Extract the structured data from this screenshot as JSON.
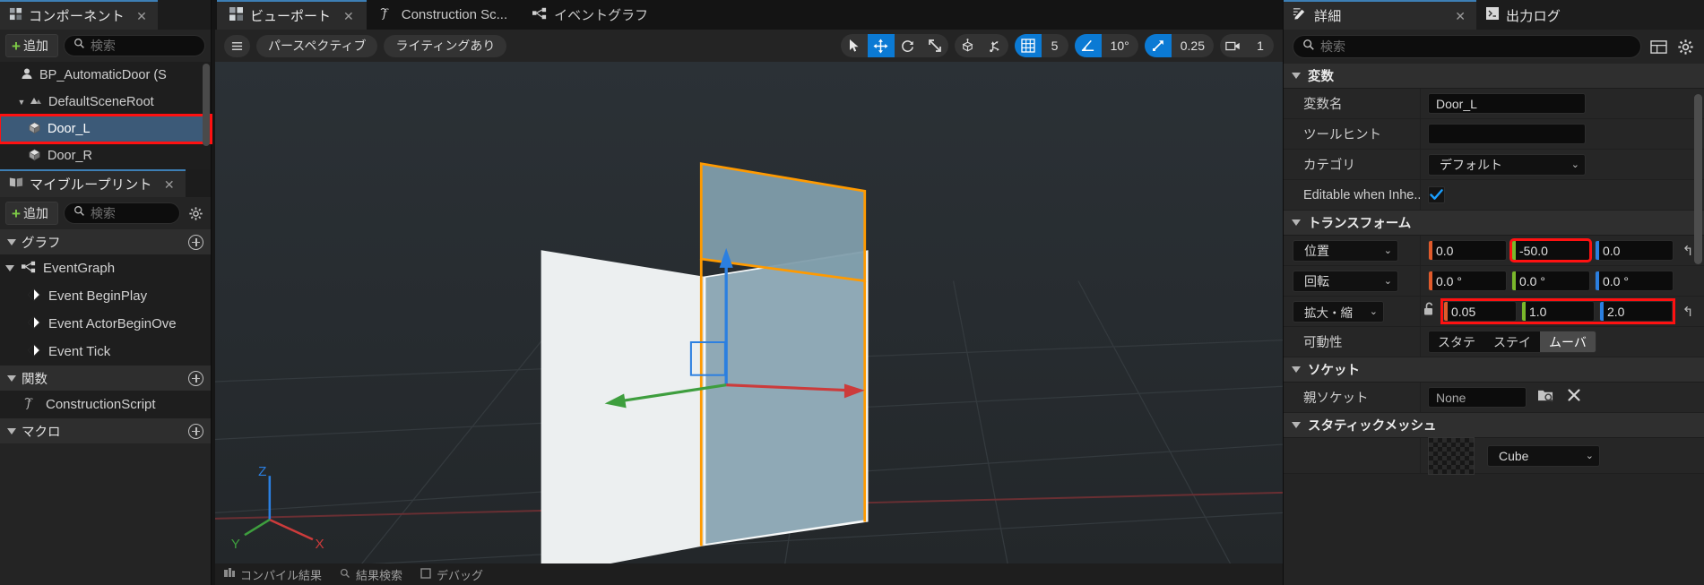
{
  "left": {
    "components_tab": {
      "label": "コンポーネント",
      "icon": "components-icon",
      "close": "✕"
    },
    "add_label": "追加",
    "search_placeholder": "検索",
    "tree": [
      {
        "label": "BP_AutomaticDoor (S",
        "icon": "actor-icon",
        "indent": 0,
        "selected": false,
        "arrow": "",
        "highlight": false
      },
      {
        "label": "DefaultSceneRoot",
        "icon": "scene-root-icon",
        "indent": 1,
        "selected": false,
        "arrow": "▼",
        "highlight": false
      },
      {
        "label": "Door_L",
        "icon": "mesh-icon",
        "indent": 2,
        "selected": true,
        "arrow": "",
        "highlight": true
      },
      {
        "label": "Door_R",
        "icon": "mesh-icon",
        "indent": 2,
        "selected": false,
        "arrow": "",
        "highlight": false
      }
    ],
    "myblueprint_tab": {
      "label": "マイブループリント",
      "icon": "book-icon",
      "close": "✕"
    },
    "sections": [
      {
        "title": "グラフ",
        "items": [
          {
            "label": "EventGraph",
            "icon": "event-graph-icon",
            "indent": 0,
            "arrow": "▼"
          },
          {
            "label": "Event BeginPlay",
            "icon": "event-node-icon",
            "indent": 1,
            "arrow": ""
          },
          {
            "label": "Event ActorBeginOve",
            "icon": "event-node-icon",
            "indent": 1,
            "arrow": ""
          },
          {
            "label": "Event Tick",
            "icon": "event-node-icon",
            "indent": 1,
            "arrow": ""
          }
        ]
      },
      {
        "title": "関数",
        "items": [
          {
            "label": "ConstructionScript",
            "icon": "function-icon",
            "indent": 1,
            "arrow": ""
          }
        ]
      },
      {
        "title": "マクロ",
        "items": []
      }
    ]
  },
  "doc_tabs": [
    {
      "label": "ビューポート",
      "icon": "viewport-icon",
      "active": true,
      "close": "✕"
    },
    {
      "label": "Construction Sc...",
      "icon": "function-icon",
      "active": false,
      "close": ""
    },
    {
      "label": "イベントグラフ",
      "icon": "event-graph-icon",
      "active": false,
      "close": ""
    }
  ],
  "viewport_toolbar": {
    "menu_icon": "hamburger-icon",
    "perspective_label": "パースペクティブ",
    "lighting_label": "ライティングあり",
    "transform_tools": [
      {
        "name": "select-tool",
        "icon": "cursor-icon",
        "active": false
      },
      {
        "name": "move-tool",
        "icon": "move-icon",
        "active": true
      },
      {
        "name": "rotate-tool",
        "icon": "rotate-icon",
        "active": false
      },
      {
        "name": "scale-tool",
        "icon": "scale-icon",
        "active": false
      }
    ],
    "coord_tools": [
      {
        "name": "world-space-toggle",
        "icon": "globe-cube-icon",
        "active": false
      },
      {
        "name": "pivot-toggle",
        "icon": "pivot-icon",
        "active": false
      }
    ],
    "grid_snap": {
      "icon": "grid-icon",
      "active": true,
      "value": "5"
    },
    "angle_snap": {
      "icon": "angle-icon",
      "active": true,
      "value": "10°"
    },
    "scale_snap": {
      "icon": "scale-snap-icon",
      "active": true,
      "value": "0.25"
    },
    "camera_speed": {
      "icon": "camera-icon",
      "active": false,
      "value": "1"
    }
  },
  "viewport_bottom": [
    {
      "label": "コンパイル結果",
      "icon": "compile-icon"
    },
    {
      "label": "結果検索",
      "icon": "search-icon"
    },
    {
      "label": "デバッグ",
      "icon": "debug-icon"
    }
  ],
  "right": {
    "tabs": [
      {
        "label": "詳細",
        "icon": "details-icon",
        "active": true,
        "close": "✕"
      },
      {
        "label": "出力ログ",
        "icon": "output-log-icon",
        "active": false,
        "close": ""
      }
    ],
    "search_placeholder": "検索",
    "column_icon": "columns-icon",
    "settings_icon": "gear-icon",
    "sections": [
      {
        "title": "変数",
        "rows": [
          {
            "kind": "text",
            "name": "変数名",
            "value": "Door_L"
          },
          {
            "kind": "text",
            "name": "ツールヒント",
            "value": ""
          },
          {
            "kind": "combo",
            "name": "カテゴリ",
            "value": "デフォルト"
          },
          {
            "kind": "check",
            "name": "Editable when Inhe...",
            "checked": true
          }
        ]
      },
      {
        "title": "トランスフォーム",
        "rows": [
          {
            "kind": "vector",
            "name": "位置",
            "values": [
              "0.0",
              "-50.0",
              "0.0"
            ],
            "highlight_index": 1,
            "highlight_all": false,
            "lock": false,
            "revert": true
          },
          {
            "kind": "vector",
            "name": "回転",
            "values": [
              "0.0 °",
              "0.0 °",
              "0.0 °"
            ],
            "highlight_index": -1,
            "highlight_all": false,
            "lock": false,
            "revert": false
          },
          {
            "kind": "vector",
            "name": "拡大・縮",
            "values": [
              "0.05",
              "1.0",
              "2.0"
            ],
            "highlight_index": -1,
            "highlight_all": true,
            "lock": true,
            "revert": true
          },
          {
            "kind": "segmented",
            "name": "可動性",
            "options": [
              "スタテ",
              "ステイ",
              "ムーバ"
            ],
            "selected": 2
          }
        ]
      },
      {
        "title": "ソケット",
        "rows": [
          {
            "kind": "socket",
            "name": "親ソケット",
            "value": "None",
            "browse_icon": "browse-icon",
            "clear_icon": "clear-icon"
          }
        ]
      },
      {
        "title": "スタティックメッシュ",
        "rows": [
          {
            "kind": "mesh",
            "name": "",
            "value": "Cube",
            "thumb": "mesh-thumbnail"
          }
        ]
      }
    ]
  },
  "colors": {
    "accent_blue": "#0b7ad4",
    "tab_accent": "#3d7fb5",
    "selection": "#3c5a78",
    "highlight_red": "#ff1111",
    "axis_x": "#e05a2b",
    "axis_y": "#7ab82b",
    "axis_z": "#2b7fe0",
    "plus_green": "#7ecb46",
    "mesh_outline": "#ff9a00"
  }
}
